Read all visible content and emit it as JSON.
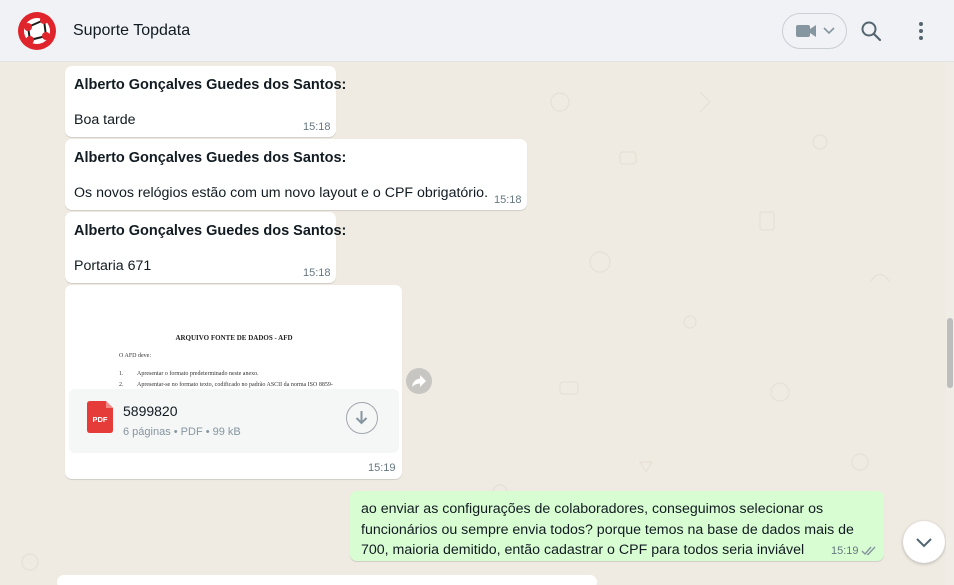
{
  "header": {
    "chat_name": "Suporte Topdata",
    "avatar_icon": "topdata-logo-icon",
    "video_icon": "video-camera-icon",
    "dropdown_icon": "chevron-down-icon",
    "search_icon": "search-icon",
    "menu_icon": "more-vertical-icon"
  },
  "messages": [
    {
      "sender": "Alberto Gonçalves Guedes dos Santos:",
      "text": "Boa tarde",
      "time": "15:18"
    },
    {
      "sender": "Alberto Gonçalves Guedes dos Santos:",
      "text": "Os novos relógios estão com um novo layout e o CPF obrigatório.",
      "time": "15:18"
    },
    {
      "sender": "Alberto Gonçalves Guedes dos Santos:",
      "text": "Portaria 671",
      "time": "15:18"
    }
  ],
  "document": {
    "preview_title": "ARQUIVO FONTE DE DADOS - AFD",
    "preview_lines": [
      "O AFD deve:",
      "1.",
      "Apresentar o formato predeterminado neste anexo.",
      "2.",
      "Apresentar-se no formato texto, codificado no padrão ASCII da norma ISO 8859-"
    ],
    "file_name": "5899820",
    "file_meta": "6 páginas • PDF • 99 kB",
    "pdf_label": "PDF",
    "time": "15:19"
  },
  "outgoing": {
    "text": "ao enviar as configurações de colaboradores, conseguimos selecionar os funcionários ou sempre envia todos? porque temos na base de dados mais de 700, maioria demitido, então cadastrar o CPF para todos seria inviável",
    "time": "15:19",
    "status_icon": "double-check-icon"
  },
  "colors": {
    "accent_red": "#e0242c",
    "outgoing_bubble": "#d9fdd3",
    "chat_background": "#efeae2"
  }
}
